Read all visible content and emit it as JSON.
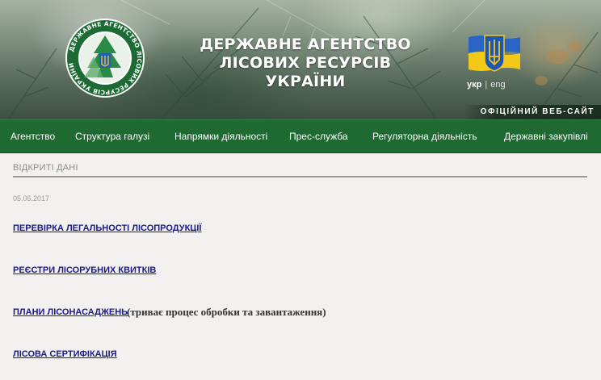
{
  "header": {
    "emblem_ring_text": "ДЕРЖАВНЕ АГЕНТСТВО ЛІСОВИХ РЕСУРСІВ УКРАЇНИ",
    "title_lines": [
      "ДЕРЖАВНЕ АГЕНТСТВО",
      "ЛІСОВИХ РЕСУРСІВ",
      "УКРАЇНИ"
    ],
    "lang_selected": "укр",
    "lang_separator": "|",
    "lang_other": "eng",
    "official_label": "ОФІЦІЙНИЙ ВЕБ-САЙТ"
  },
  "nav": {
    "items": [
      "Агентство",
      "Структура галузі",
      "Напрямки діяльності",
      "Прес-служба",
      "Регуляторна діяльність",
      "Державні закупівлі"
    ]
  },
  "content": {
    "section_title": "ВІДКРИТІ ДАНІ",
    "date": "05.05.2017",
    "links": [
      "ПЕРЕВІРКА ЛЕГАЛЬНОСТІ ЛІСОПРОДУКЦІЇ",
      "РЕЄСТРИ ЛІСОРУБНИХ КВИТКІВ",
      "ПЛАНИ ЛІСОНАСАДЖЕНЬ",
      "ЛІСОВА СЕРТИФІКАЦІЯ"
    ],
    "plans_note": "(триває процес обробки та завантаження)"
  },
  "colors": {
    "nav_green": "#1e6a32",
    "link_blue": "#1a1a8a",
    "flag_blue": "#2a64c4",
    "flag_yellow": "#f2c819"
  },
  "icons": [
    "forest-emblem-icon",
    "trident-coat-of-arms-icon"
  ]
}
